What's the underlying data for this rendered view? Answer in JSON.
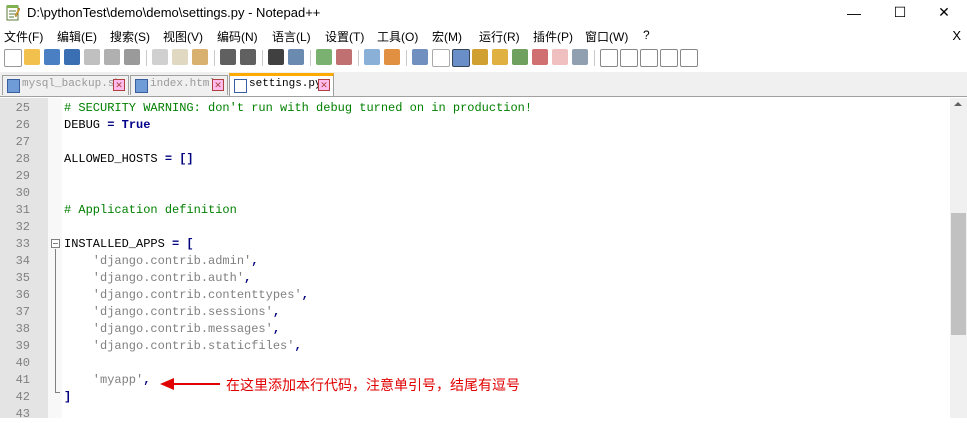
{
  "window": {
    "title": "D:\\pythonTest\\demo\\demo\\settings.py - Notepad++",
    "minimize": "—",
    "maximize": "☐",
    "close": "✕"
  },
  "menu": {
    "items": [
      "文件(F)",
      "编辑(E)",
      "搜索(S)",
      "视图(V)",
      "编码(N)",
      "语言(L)",
      "设置(T)",
      "工具(O)",
      "宏(M)",
      "运行(R)",
      "插件(P)",
      "窗口(W)",
      "?"
    ],
    "close_doc": "X"
  },
  "tabs": [
    {
      "label": "mysql_backup.sh",
      "close": "✕",
      "active": false
    },
    {
      "label": "index.html",
      "close": "✕",
      "active": false
    },
    {
      "label": "settings.py",
      "close": "✕",
      "active": true
    }
  ],
  "editor": {
    "lines": [
      {
        "num": "25",
        "tokens": [
          {
            "t": "# SECURITY WARNING: don't run with debug turned on in production!",
            "k": "comment"
          }
        ]
      },
      {
        "num": "26",
        "tokens": [
          {
            "t": "DEBUG",
            "k": "id"
          },
          {
            "t": " = ",
            "k": "op"
          },
          {
            "t": "True",
            "k": "kw"
          }
        ]
      },
      {
        "num": "27",
        "tokens": []
      },
      {
        "num": "28",
        "tokens": [
          {
            "t": "ALLOWED_HOSTS",
            "k": "id"
          },
          {
            "t": " = []",
            "k": "op"
          }
        ]
      },
      {
        "num": "29",
        "tokens": []
      },
      {
        "num": "30",
        "tokens": []
      },
      {
        "num": "31",
        "tokens": [
          {
            "t": "# Application definition",
            "k": "comment"
          }
        ]
      },
      {
        "num": "32",
        "tokens": []
      },
      {
        "num": "33",
        "tokens": [
          {
            "t": "INSTALLED_APPS",
            "k": "id"
          },
          {
            "t": " = [",
            "k": "op"
          }
        ]
      },
      {
        "num": "34",
        "tokens": [
          {
            "t": "    'django.contrib.admin'",
            "k": "str"
          },
          {
            "t": ",",
            "k": "op"
          }
        ]
      },
      {
        "num": "35",
        "tokens": [
          {
            "t": "    'django.contrib.auth'",
            "k": "str"
          },
          {
            "t": ",",
            "k": "op"
          }
        ]
      },
      {
        "num": "36",
        "tokens": [
          {
            "t": "    'django.contrib.contenttypes'",
            "k": "str"
          },
          {
            "t": ",",
            "k": "op"
          }
        ]
      },
      {
        "num": "37",
        "tokens": [
          {
            "t": "    'django.contrib.sessions'",
            "k": "str"
          },
          {
            "t": ",",
            "k": "op"
          }
        ]
      },
      {
        "num": "38",
        "tokens": [
          {
            "t": "    'django.contrib.messages'",
            "k": "str"
          },
          {
            "t": ",",
            "k": "op"
          }
        ]
      },
      {
        "num": "39",
        "tokens": [
          {
            "t": "    'django.contrib.staticfiles'",
            "k": "str"
          },
          {
            "t": ",",
            "k": "op"
          }
        ]
      },
      {
        "num": "40",
        "tokens": []
      },
      {
        "num": "41",
        "tokens": [
          {
            "t": "    'myapp'",
            "k": "str"
          },
          {
            "t": ",",
            "k": "op"
          }
        ]
      },
      {
        "num": "42",
        "tokens": [
          {
            "t": "]",
            "k": "op"
          }
        ]
      },
      {
        "num": "43",
        "tokens": []
      }
    ]
  },
  "annotation": {
    "text": "在这里添加本行代码，注意单引号，结尾有逗号",
    "color": "#e00000"
  },
  "colors": {
    "comment": "#008000",
    "operator": "#000080",
    "keyword": "#00008b",
    "string": "#808080",
    "active_tab_accent": "#ffaa00"
  }
}
